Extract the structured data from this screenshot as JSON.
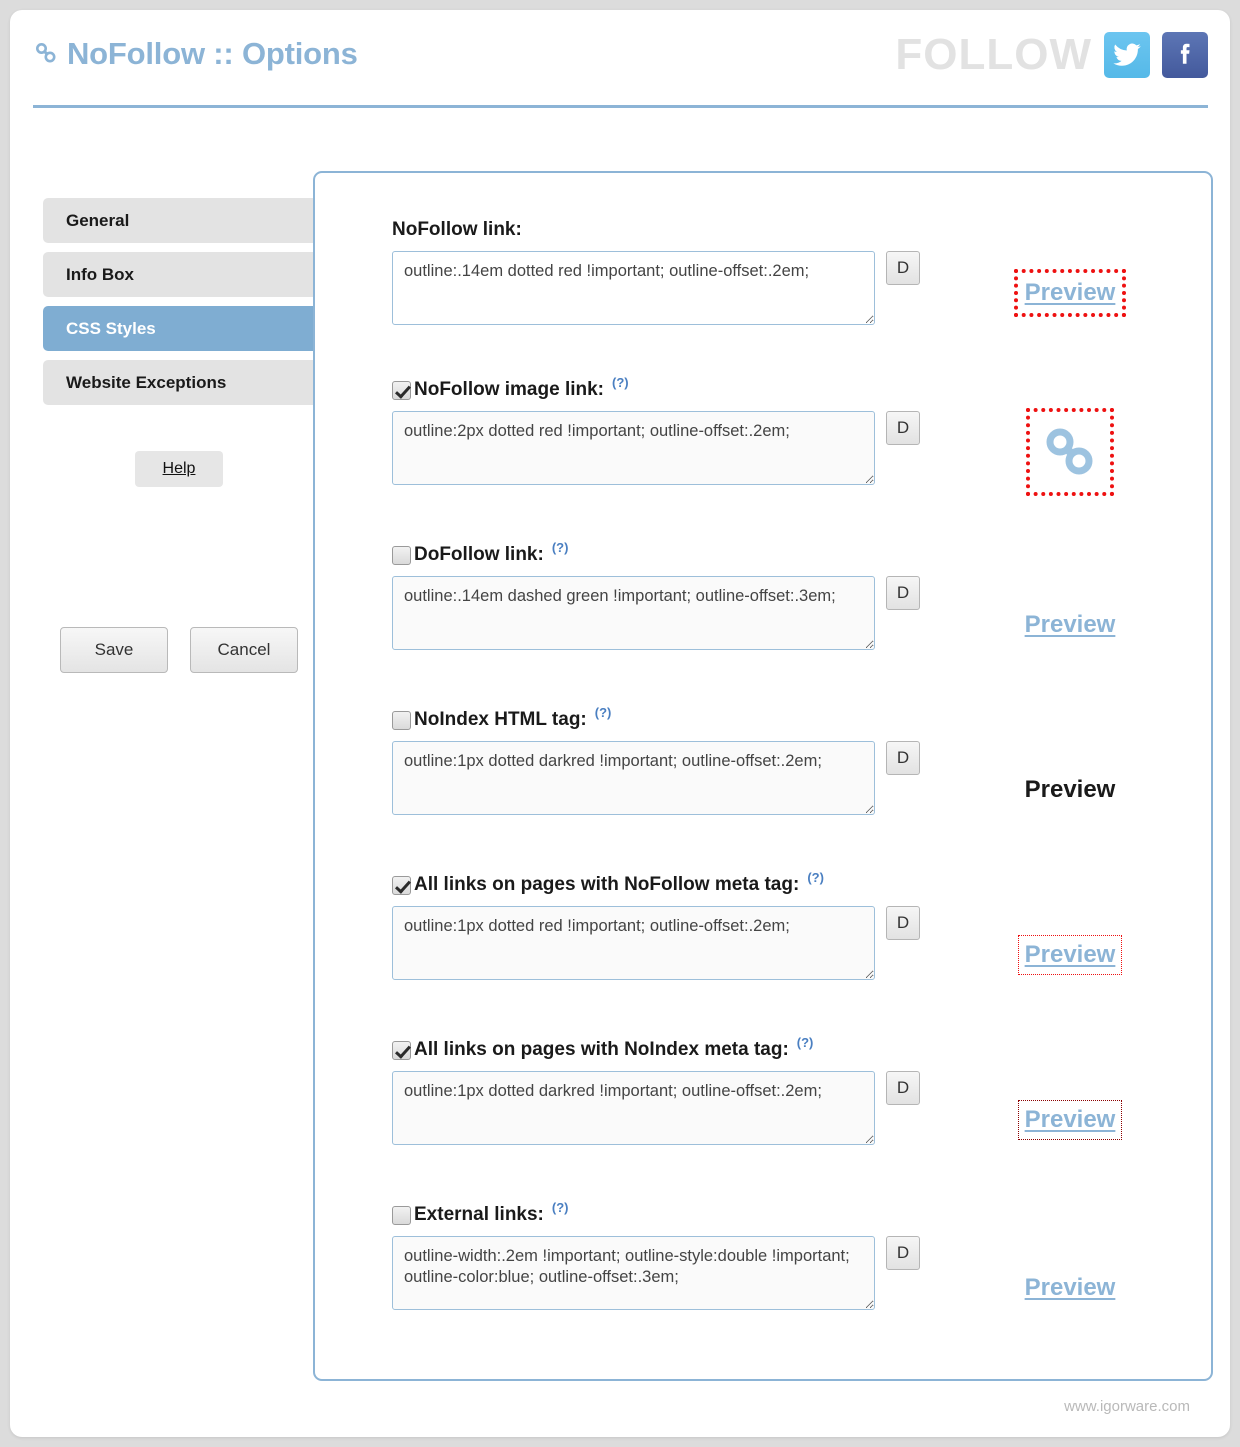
{
  "header": {
    "title": "NoFollow :: Options",
    "title_icon": "chain-link-icon",
    "follow_label": "FOLLOW",
    "twitter_icon": "twitter-icon",
    "facebook_icon": "facebook-icon"
  },
  "sidebar": {
    "tabs": [
      {
        "label": "General",
        "active": false
      },
      {
        "label": "Info Box",
        "active": false
      },
      {
        "label": "CSS Styles",
        "active": true
      },
      {
        "label": "Website Exceptions",
        "active": false
      }
    ],
    "help_label": "Help",
    "save_label": "Save",
    "cancel_label": "Cancel"
  },
  "fields": [
    {
      "label": "NoFollow link:",
      "has_checkbox": false,
      "checked": false,
      "has_help": false,
      "help_label": "(?)",
      "value": "outline:.14em dotted red !important; outline-offset:.2em;",
      "default_button": "D",
      "preview_label": "Preview",
      "preview_kind": "link-outline-red-thick"
    },
    {
      "label": "NoFollow image link:",
      "has_checkbox": true,
      "checked": true,
      "has_help": true,
      "help_label": "(?)",
      "value": "outline:2px dotted red !important; outline-offset:.2em;",
      "default_button": "D",
      "preview_label": "",
      "preview_kind": "image-outline-red-thick"
    },
    {
      "label": "DoFollow link:",
      "has_checkbox": true,
      "checked": false,
      "has_help": true,
      "help_label": "(?)",
      "value": "outline:.14em dashed green !important; outline-offset:.3em;",
      "default_button": "D",
      "preview_label": "Preview",
      "preview_kind": "link-plain"
    },
    {
      "label": "NoIndex HTML tag:",
      "has_checkbox": true,
      "checked": false,
      "has_help": true,
      "help_label": "(?)",
      "value": "outline:1px dotted darkred !important; outline-offset:.2em;",
      "default_button": "D",
      "preview_label": "Preview",
      "preview_kind": "text-bold"
    },
    {
      "label": "All links on pages with NoFollow meta tag:",
      "has_checkbox": true,
      "checked": true,
      "has_help": true,
      "help_label": "(?)",
      "value": "outline:1px dotted red !important; outline-offset:.2em;",
      "default_button": "D",
      "preview_label": "Preview",
      "preview_kind": "link-outline-red-thin"
    },
    {
      "label": "All links on pages with NoIndex meta tag:",
      "has_checkbox": true,
      "checked": true,
      "has_help": true,
      "help_label": "(?)",
      "value": "outline:1px dotted darkred !important; outline-offset:.2em;",
      "default_button": "D",
      "preview_label": "Preview",
      "preview_kind": "link-outline-darkred-thin"
    },
    {
      "label": "External links:",
      "has_checkbox": true,
      "checked": false,
      "has_help": true,
      "help_label": "(?)",
      "value": "outline-width:.2em !important; outline-style:double !important; outline-color:blue; outline-offset:.3em;",
      "default_button": "D",
      "preview_label": "Preview",
      "preview_kind": "link-plain"
    }
  ],
  "footer": {
    "site": "www.igorware.com"
  },
  "colors": {
    "accent_blue": "#8cb4d6",
    "tab_active": "#7fadd2",
    "tab_bg": "#e3e3e3",
    "outline_red": "#ee1111",
    "outline_darkred": "#8b0000",
    "page_bg": "#dcdcdc"
  }
}
